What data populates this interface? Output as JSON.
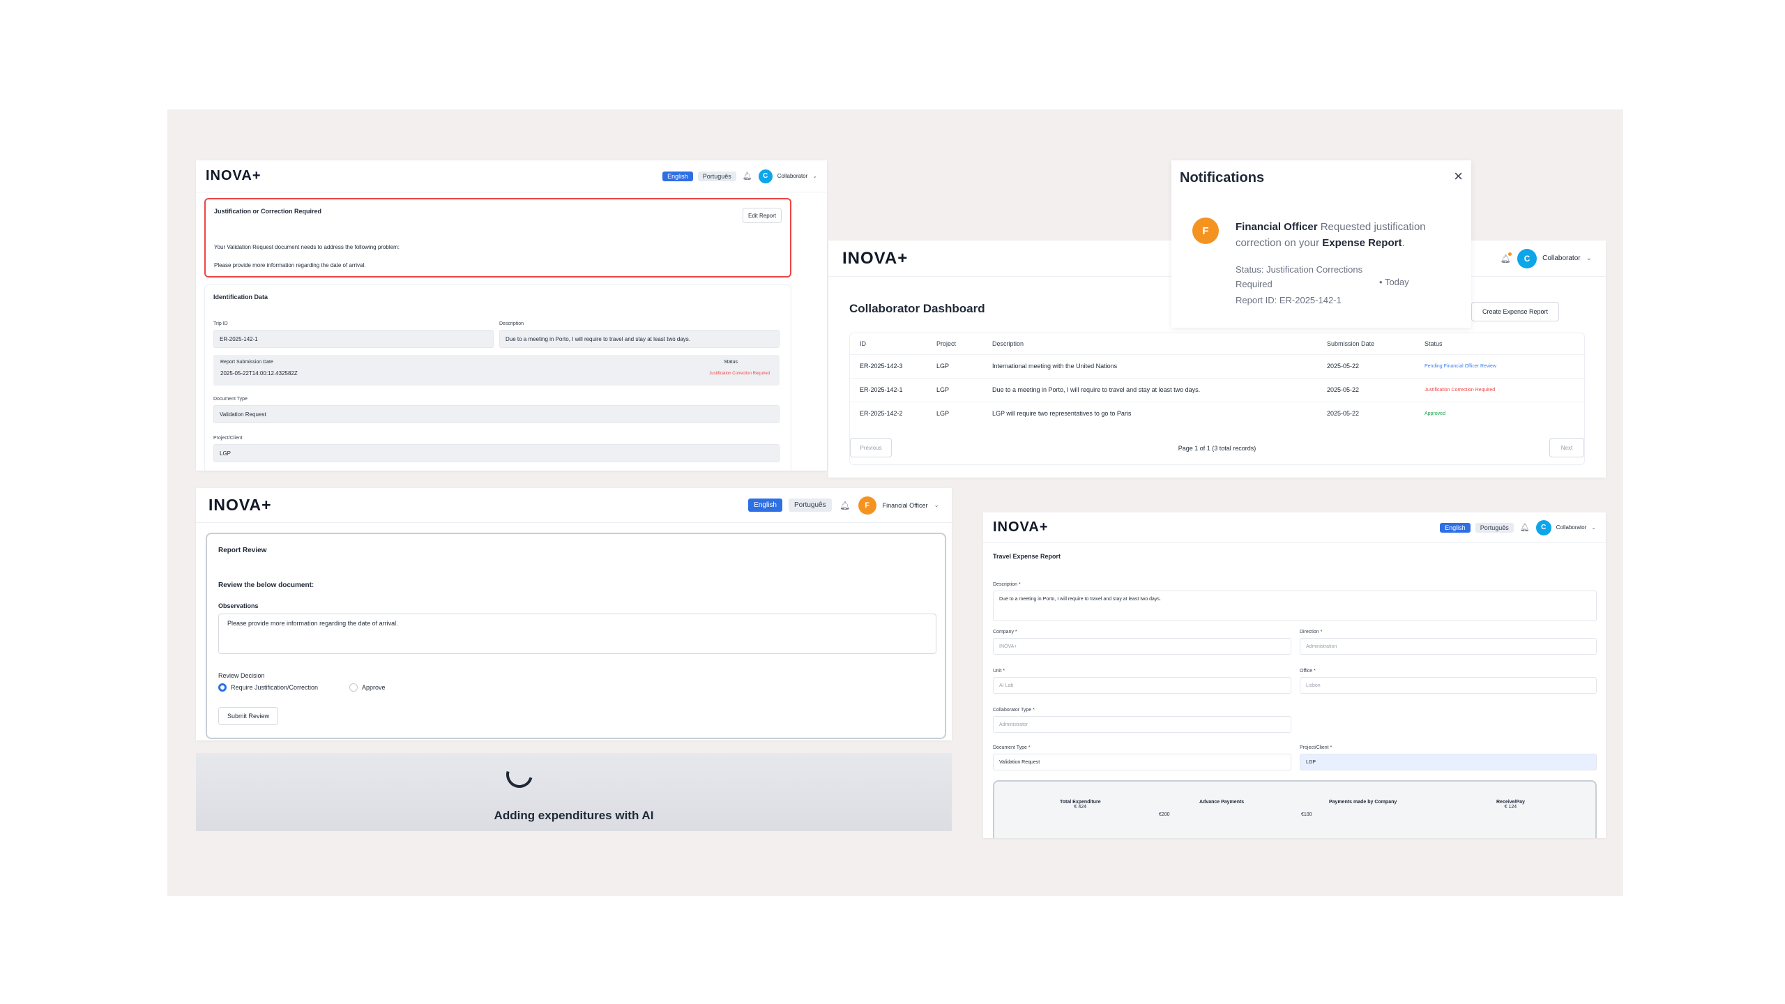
{
  "brand": {
    "logo": "INOVA+",
    "accent": "#2f6fe4",
    "alert_red": "#ef4444",
    "orange": "#f59321"
  },
  "lang": {
    "english": "English",
    "portuguese": "Português"
  },
  "roles": {
    "collaborator": "Collaborator",
    "financial_officer": "Financial Officer"
  },
  "panel1": {
    "avatar": "C",
    "alert": {
      "title": "Justification or Correction Required",
      "button": "Edit Report",
      "line1": "Your Validation Request document needs to address the following problem:",
      "line2": "Please provide more information regarding the date of arrival."
    },
    "section_title": "Identification Data",
    "trip_id_label": "Trip ID",
    "trip_id_value": "ER-2025-142-1",
    "description_label": "Description",
    "description_value": "Due to a meeting in Porto, I will require to travel and stay at least two days.",
    "submission_date_label": "Report Submission Date",
    "submission_date_value": "2025-05-22T14:00:12.432582Z",
    "status_label": "Status",
    "status_value": "Justification Correction Required",
    "document_type_label": "Document Type",
    "document_type_value": "Validation Request",
    "project_label": "Project/Client",
    "project_value": "LGP"
  },
  "panel2": {
    "avatar": "C",
    "title": "Collaborator Dashboard",
    "create_button": "Create Expense Report",
    "columns": [
      "ID",
      "Project",
      "Description",
      "Submission Date",
      "Status"
    ],
    "rows": [
      {
        "id": "ER-2025-142-3",
        "project": "LGP",
        "description": "International meeting with the United Nations",
        "date": "2025-05-22",
        "status": "Pending Financial Officer Review",
        "status_color": "#3b82f6"
      },
      {
        "id": "ER-2025-142-1",
        "project": "LGP",
        "description": "Due to a meeting in Porto, I will require to travel and stay at least two days.",
        "date": "2025-05-22",
        "status": "Justification Correction Required",
        "status_color": "#ef4444"
      },
      {
        "id": "ER-2025-142-2",
        "project": "LGP",
        "description": "LGP will require two representatives to go to Paris",
        "date": "2025-05-22",
        "status": "Approved",
        "status_color": "#16a34a"
      }
    ],
    "previous": "Previous",
    "page_info": "Page 1 of 1 (3 total records)",
    "next": "Next"
  },
  "notifications": {
    "title": "Notifications",
    "avatar": "F",
    "sender": "Financial Officer",
    "message": "Requested justification correction on your",
    "target": "Expense Report",
    "status_line1": "Status: Justification Corrections",
    "status_line2": "Required",
    "time": "Today",
    "report_id": "Report ID: ER-2025-142-1"
  },
  "panel3": {
    "avatar": "F",
    "card_title": "Report Review",
    "review_heading": "Review the below document:",
    "observations_label": "Observations",
    "observations_value": "Please provide more information regarding the date of arrival.",
    "decision_label": "Review Decision",
    "option_require": "Require Justification/Correction",
    "option_approve": "Approve",
    "submit": "Submit Review",
    "loading_text": "Adding expenditures with AI"
  },
  "panel4": {
    "avatar": "C",
    "title": "Travel Expense Report",
    "description_label": "Description *",
    "description_value": "Due to a meeting in Porto, I will require to travel and stay at least two days.",
    "company_label": "Company *",
    "company_value": "INOVA+",
    "direction_label": "Direction *",
    "direction_value": "Administration",
    "unit_label": "Unit *",
    "unit_value": "AI Lab",
    "office_label": "Office *",
    "office_value": "Lisbon",
    "collab_type_label": "Collaborator Type *",
    "collab_type_value": "Administrator",
    "doc_type_label": "Document Type *",
    "doc_type_value": "Validation Request",
    "project_label": "Project/Client *",
    "project_value": "LGP",
    "totals": {
      "total_label": "Total Expenditure",
      "total_value": "€ 424",
      "advance_label": "Advance Payments",
      "advance_value": "€200",
      "company_label": "Payments made by Company",
      "company_value": "€100",
      "receive_label": "Receive/Pay",
      "receive_value": "€ 124"
    }
  }
}
